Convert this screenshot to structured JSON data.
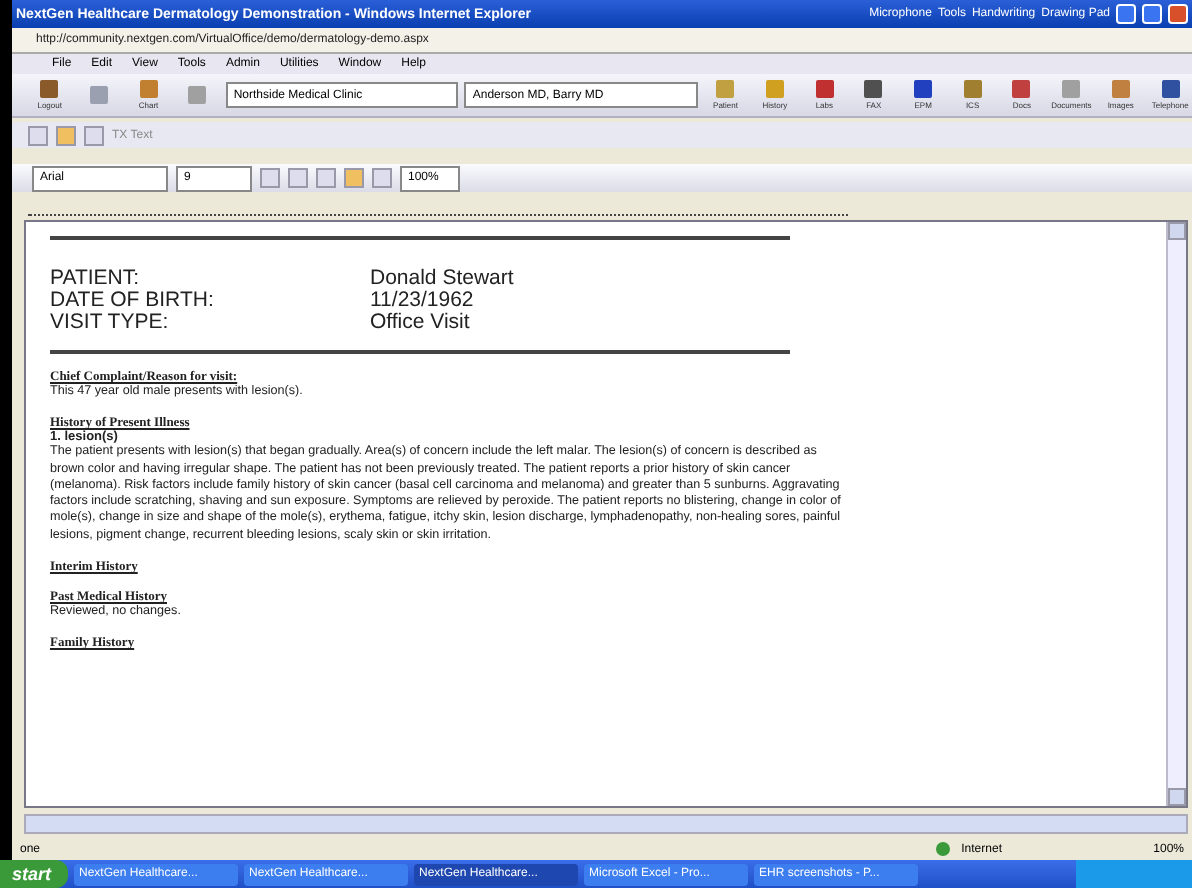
{
  "window": {
    "title": "NextGen Healthcare Dermatology Demonstration - Windows Internet Explorer"
  },
  "language_bar": [
    "Microphone",
    "Tools",
    "Handwriting",
    "Drawing Pad"
  ],
  "address": "http://community.nextgen.com/VirtualOffice/demo/dermatology-demo.aspx",
  "menu": [
    "File",
    "Edit",
    "View",
    "Tools",
    "Admin",
    "Utilities",
    "Window",
    "Help"
  ],
  "toolbar": {
    "left": [
      {
        "label": "Logout",
        "color": "#8a5a2a"
      },
      {
        "color": "#9aa0b0"
      },
      {
        "label": "Chart",
        "color": "#c08030"
      },
      {
        "color": "#a0a0a0"
      }
    ],
    "practice": "Northside Medical Clinic",
    "provider": "Anderson MD, Barry  MD",
    "right": [
      {
        "label": "Patient",
        "color": "#c0a040"
      },
      {
        "label": "History",
        "color": "#d0a020"
      },
      {
        "label": "Labs",
        "color": "#c03030"
      },
      {
        "label": "FAX",
        "color": "#505050"
      },
      {
        "label": "EPM",
        "color": "#2040c0"
      },
      {
        "label": "ICS",
        "color": "#a08030"
      },
      {
        "label": "Docs",
        "color": "#c04040"
      },
      {
        "label": "Documents",
        "color": "#a0a0a0"
      },
      {
        "label": "Images",
        "color": "#c08040"
      },
      {
        "label": "Telephone",
        "color": "#3050a0"
      }
    ]
  },
  "editor_toolbar": {
    "label": "TX Text"
  },
  "format": {
    "font": "Arial",
    "size": "9",
    "zoom": "100%"
  },
  "document": {
    "header": [
      {
        "label": "PATIENT:",
        "value": "Donald Stewart"
      },
      {
        "label": "DATE OF BIRTH:",
        "value": "11/23/1962"
      },
      {
        "label": "VISIT TYPE:",
        "value": "Office Visit"
      }
    ],
    "sections": [
      {
        "heading": "Chief Complaint/Reason for visit:",
        "text": "This 47 year old male presents with lesion(s)."
      },
      {
        "heading": "History of Present Illness",
        "subheading": "1.  lesion(s)",
        "text": " The patient presents with lesion(s) that began gradually. Area(s) of concern include the left malar. The lesion(s) of concern is described as brown color and having irregular shape. The patient has not been previously treated. The patient reports a prior history of skin cancer (melanoma). Risk factors include family history of skin cancer (basal cell carcinoma and melanoma) and greater than 5 sunburns.  Aggravating factors include scratching, shaving and sun exposure.  Symptoms are relieved by peroxide. The patient reports no blistering, change in color of mole(s), change in size and shape of the mole(s), erythema, fatigue, itchy skin, lesion discharge, lymphadenopathy, non-healing sores, painful lesions, pigment change, recurrent bleeding lesions, scaly skin or skin irritation."
      },
      {
        "heading": "Interim History"
      },
      {
        "heading": "Past Medical History",
        "text": "Reviewed, no changes."
      },
      {
        "heading": "Family History"
      }
    ]
  },
  "status_bar": {
    "status": "one",
    "zone": "Internet",
    "zoom": "100%"
  },
  "taskbar": {
    "start": "start",
    "items": [
      {
        "label": "NextGen Healthcare...",
        "selected": false
      },
      {
        "label": "NextGen Healthcare...",
        "selected": false
      },
      {
        "label": "NextGen Healthcare...",
        "selected": true
      },
      {
        "label": "Microsoft Excel - Pro...",
        "selected": false
      },
      {
        "label": "EHR screenshots - P...",
        "selected": false
      }
    ]
  }
}
